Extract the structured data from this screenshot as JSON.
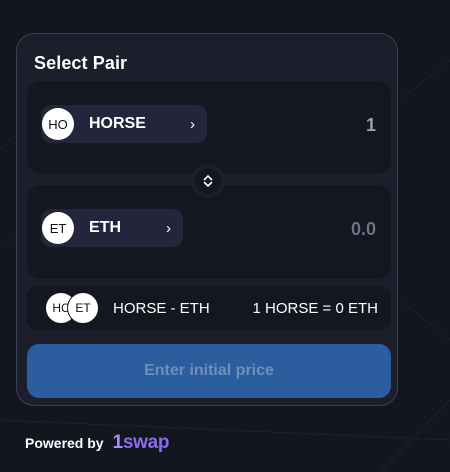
{
  "widget": {
    "title": "Select Pair"
  },
  "from": {
    "logo_text": "HO",
    "symbol": "HORSE",
    "chevron": "›",
    "amount": "1"
  },
  "switch": {
    "icon": "chevron-up-down-icon"
  },
  "to": {
    "logo_text": "ET",
    "symbol": "ETH",
    "chevron": "›",
    "amount": "0.0"
  },
  "pair": {
    "logo_a": "HC",
    "logo_b": "ET",
    "name": "HORSE - ETH",
    "price": "1 HORSE = 0 ETH"
  },
  "action": {
    "label": "Enter initial price"
  },
  "footer": {
    "powered_by": "Powered by",
    "brand_prefix": "1",
    "brand_rest": "swap"
  },
  "colors": {
    "background": "#13151f",
    "card": "#1c1f2b",
    "panel": "#141620",
    "button": "#2c5d9f",
    "brand": "#8b6cf0"
  }
}
